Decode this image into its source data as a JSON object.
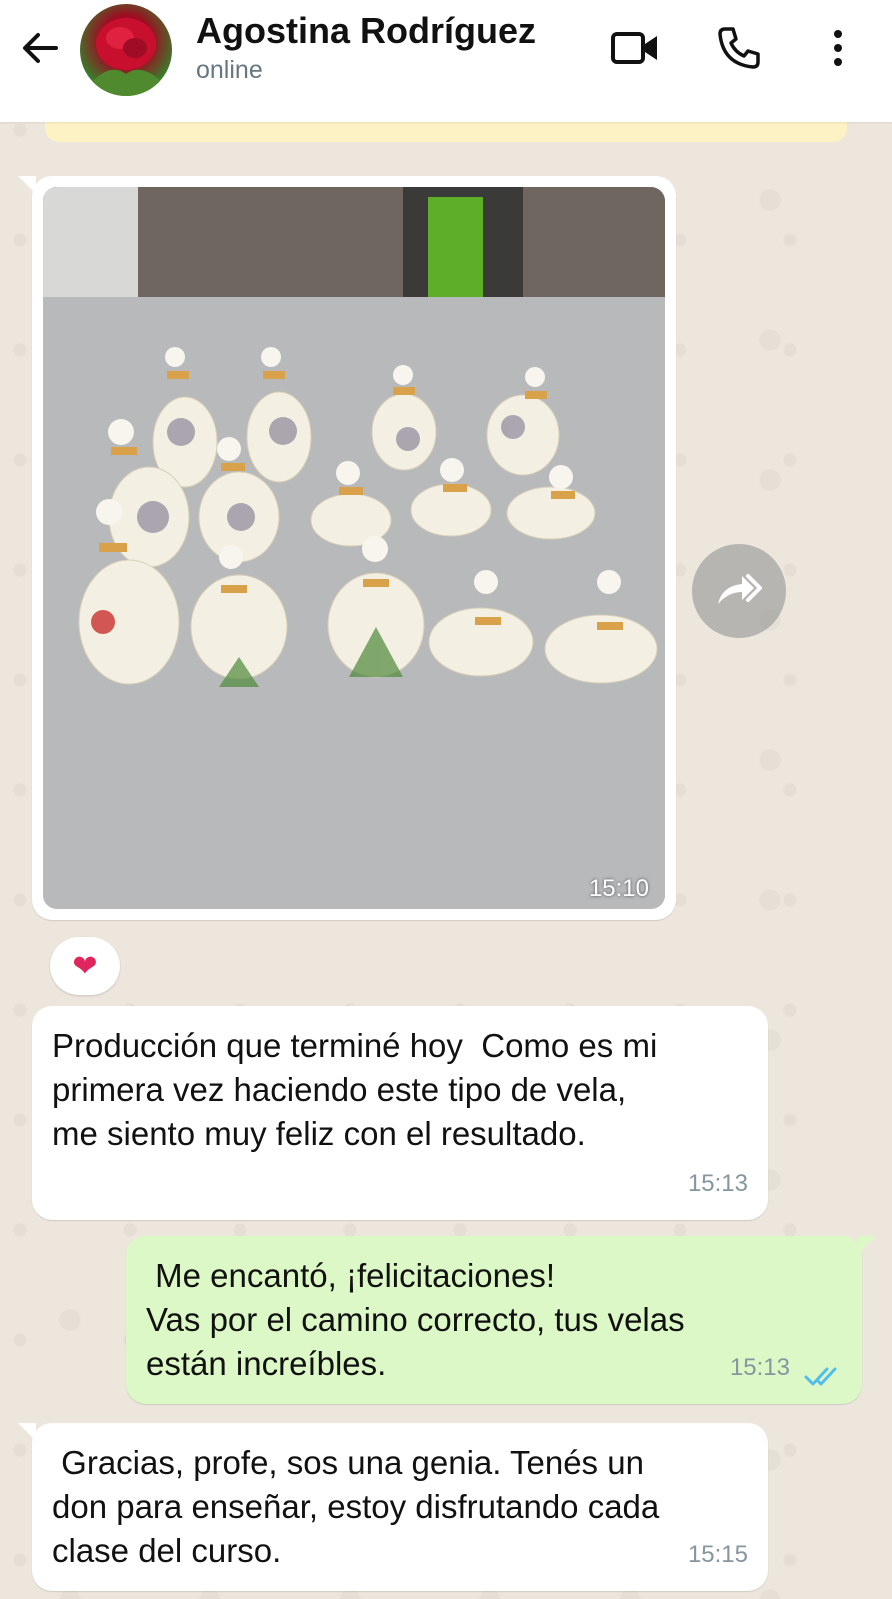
{
  "header": {
    "contact_name": "Agostina Rodríguez",
    "status": "online",
    "icons": [
      "back-arrow-icon",
      "video-call-icon",
      "phone-icon",
      "more-vert-icon"
    ]
  },
  "messages": [
    {
      "type": "image",
      "direction": "incoming",
      "time": "15:10",
      "reaction": "❤"
    },
    {
      "type": "text",
      "direction": "incoming",
      "text": "Producción que terminé hoy  Como es mi\nprimera vez haciendo este tipo de vela,\nme siento muy feliz con el resultado.",
      "time": "15:13"
    },
    {
      "type": "text",
      "direction": "outgoing",
      "text": " Me encantó, ¡felicitaciones!\nVas por el camino correcto, tus velas\nestán increíbles.",
      "time": "15:13",
      "read_status": "read"
    },
    {
      "type": "text",
      "direction": "incoming",
      "text": " Gracias, profe, sos una genia. Tenés un\ndon para enseñar, estoy disfrutando cada\nclase del curso.",
      "time": "15:15"
    }
  ],
  "colors": {
    "outgoing_bubble": "#dcf8c6",
    "incoming_bubble": "#ffffff",
    "read_ticks": "#53bdeb",
    "chat_background": "#ece6dd"
  }
}
